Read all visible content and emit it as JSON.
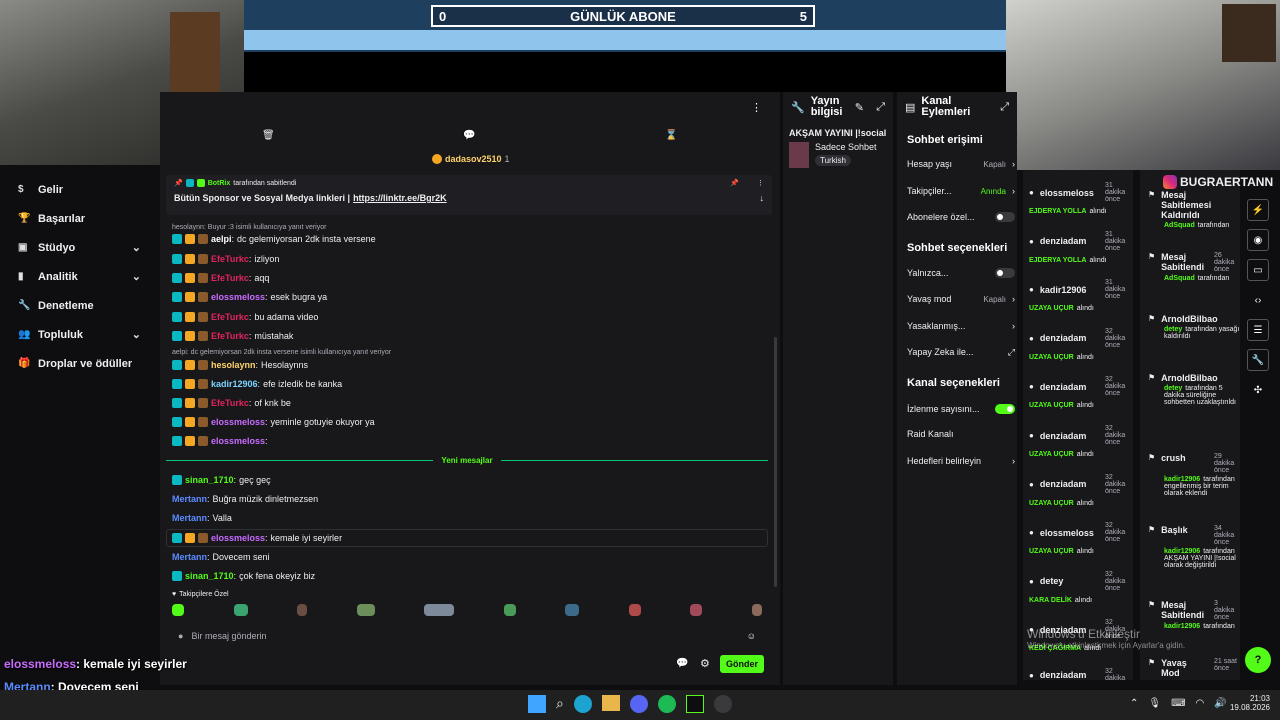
{
  "counter": {
    "left": "0",
    "title": "GÜNLÜK ABONE",
    "right": "5"
  },
  "sidebar": {
    "items": [
      {
        "label": "Gelir",
        "chevron": false
      },
      {
        "label": "Başarılar",
        "chevron": false
      },
      {
        "label": "Stüdyo",
        "chevron": true
      },
      {
        "label": "Analitik",
        "chevron": true
      },
      {
        "label": "Denetleme",
        "chevron": false
      },
      {
        "label": "Topluluk",
        "chevron": true
      },
      {
        "label": "Droplar ve ödüller",
        "chevron": false
      }
    ]
  },
  "chat": {
    "top_user": "dadasov2510",
    "top_user_count": "1",
    "pinned": {
      "by": "BotRix",
      "by_suffix": "tarafından sabitlendi",
      "text": "Bütün Sponsor ve Sosyal Medya linkleri |",
      "link": "https://linktr.ee/Bgr2K"
    },
    "reply1": "hesolaynn: Buyur :3 isimli kullanıcıya yanıt veriyor",
    "reply2": "aelpi: dc gelemiyorsan 2dk insta versene isimli kullanıcıya yanıt veriyor",
    "messages": [
      {
        "user": "aelpi",
        "color": "#ffffff",
        "text": "dc gelemiyorsan 2dk insta versene"
      },
      {
        "user": "EfeTurkc",
        "color": "#e0245e",
        "text": "izliyon"
      },
      {
        "user": "EfeTurkc",
        "color": "#e0245e",
        "text": "aqq"
      },
      {
        "user": "elossmeloss",
        "color": "#c86bff",
        "text": "esek bugra ya"
      },
      {
        "user": "EfeTurkc",
        "color": "#e0245e",
        "text": "bu adama video"
      },
      {
        "user": "EfeTurkc",
        "color": "#e0245e",
        "text": "müstahak"
      },
      {
        "user": "hesolaynn",
        "color": "#ffd36b",
        "text": "Hesolaynns"
      },
      {
        "user": "kadir12906",
        "color": "#7ad4ff",
        "text": "efe izledik be kanka"
      },
      {
        "user": "EfeTurkc",
        "color": "#e0245e",
        "text": "of knk be"
      },
      {
        "user": "elossmeloss",
        "color": "#c86bff",
        "text": "yeminle gotuyie okuyor ya"
      },
      {
        "user": "elossmeloss",
        "color": "#c86bff",
        "text": ""
      }
    ],
    "new_label": "Yeni mesajlar",
    "new_messages": [
      {
        "user": "sinan_1710",
        "color": "#53fc18",
        "text": "geç geç"
      },
      {
        "user": "Mertann",
        "color": "#5b8cff",
        "text": "Buğra müzik dinletmezsen"
      },
      {
        "user": "Mertann",
        "color": "#5b8cff",
        "text": "Valla"
      },
      {
        "user": "elossmeloss",
        "color": "#c86bff",
        "text": "kemale iyi seyirler"
      },
      {
        "user": "Mertann",
        "color": "#5b8cff",
        "text": "Dovecem seni"
      },
      {
        "user": "sinan_1710",
        "color": "#53fc18",
        "text": "çok fena okeyiz biz"
      }
    ],
    "followers_label": "Takipçilere Özel",
    "input_placeholder": "Bir mesaj gönderin",
    "send_label": "Gönder"
  },
  "stream_info": {
    "title": "Yayın bilgisi",
    "stream_title": "AKŞAM YAYINI |!social",
    "category": "Sadece Sohbet",
    "tag": "Turkish"
  },
  "channel_actions": {
    "title": "Kanal Eylemleri",
    "chat_access": "Sohbet erişimi",
    "rows1": [
      {
        "label": "Hesap yaşı",
        "value": "Kapalı"
      },
      {
        "label": "Takipçiler...",
        "value": "Anında"
      },
      {
        "label": "Abonelere özel...",
        "value": ""
      }
    ],
    "chat_options": "Sohbet seçenekleri",
    "rows2": [
      {
        "label": "Yalnızca...",
        "value": ""
      },
      {
        "label": "Yavaş mod",
        "value": "Kapalı"
      },
      {
        "label": "Yasaklanmış...",
        "value": ""
      },
      {
        "label": "Yapay Zeka ile...",
        "value": ""
      }
    ],
    "channel_options": "Kanal seçenekleri",
    "rows3": [
      {
        "label": "İzlenme sayısını...",
        "value": ""
      },
      {
        "label": "Raid Kanalı",
        "value": ""
      },
      {
        "label": "Hedefleri belirleyin",
        "value": ""
      }
    ]
  },
  "activity": [
    {
      "user": "elossmeloss",
      "time": "31 dakika önce",
      "action": "EJDERYA YOLLA",
      "suffix": "alındı"
    },
    {
      "user": "denziadam",
      "time": "31 dakika önce",
      "action": "EJDERYA YOLLA",
      "suffix": "alındı"
    },
    {
      "user": "kadir12906",
      "time": "31 dakika önce",
      "action": "UZAYA UÇUR",
      "suffix": "alındı"
    },
    {
      "user": "denziadam",
      "time": "32 dakika önce",
      "action": "UZAYA UÇUR",
      "suffix": "alındı"
    },
    {
      "user": "denziadam",
      "time": "32 dakika önce",
      "action": "UZAYA UÇUR",
      "suffix": "alındı"
    },
    {
      "user": "denziadam",
      "time": "32 dakika önce",
      "action": "UZAYA UÇUR",
      "suffix": "alındı"
    },
    {
      "user": "denziadam",
      "time": "32 dakika önce",
      "action": "UZAYA UÇUR",
      "suffix": "alındı"
    },
    {
      "user": "elossmeloss",
      "time": "32 dakika önce",
      "action": "UZAYA UÇUR",
      "suffix": "alındı"
    },
    {
      "user": "detey",
      "time": "32 dakika önce",
      "action": "KARA DELİK",
      "suffix": "alındı"
    },
    {
      "user": "denziadam",
      "time": "32 dakika önce",
      "action": "KEDİ ÇAĞIRMA",
      "suffix": "alındı"
    },
    {
      "user": "denziadam",
      "time": "32 dakika",
      "action": "",
      "suffix": ""
    }
  ],
  "moderation": [
    {
      "title": "Mesaj Sabitlemesi Kaldırıldı",
      "by": "AdSquad",
      "suffix": "tarafından",
      "time": ""
    },
    {
      "title": "Mesaj Sabitlendi",
      "by": "AdSquad",
      "suffix": "tarafından",
      "time": "26 dakika önce"
    },
    {
      "title": "ArnoldBilbao",
      "by": "detey",
      "suffix": "tarafından yasağı kaldırıldı",
      "time": ""
    },
    {
      "title": "ArnoldBilbao",
      "by": "detey",
      "suffix": "tarafından 5 dakika süreliğine sohbetten uzaklaştırıldı",
      "time": ""
    },
    {
      "title": "crush",
      "by": "kadir12906",
      "suffix": "tarafından engellenmiş bir terim olarak eklendi",
      "time": "29 dakika önce"
    },
    {
      "title": "Başlık",
      "by": "kadir12906",
      "suffix": "tarafından AKŞAM YAYINI |!social olarak değiştirildi",
      "time": "34 dakika önce"
    },
    {
      "title": "Mesaj Sabitlendi",
      "by": "kadir12906",
      "suffix": "tarafından",
      "time": "3 dakika önce"
    },
    {
      "title": "Yavaş Mod",
      "by": "",
      "suffix": "",
      "time": "21 saat önce"
    }
  ],
  "overlay": {
    "instagram": "BUGRAERTANN",
    "lines": [
      {
        "user": "elossmeloss",
        "text": ": kemale iyi seyirler"
      },
      {
        "user": "Mertann",
        "text": ": Dovecem seni"
      },
      {
        "user": "sinan_1710",
        "text": ": çok fena okeyiz biz"
      }
    ],
    "watermark1": "Windows'u Etkinleştir",
    "watermark2": "Windows'u etkinleştirmek için Ayarlar'a gidin."
  },
  "taskbar": {
    "time": "21:03",
    "date": "19.08.2026"
  }
}
